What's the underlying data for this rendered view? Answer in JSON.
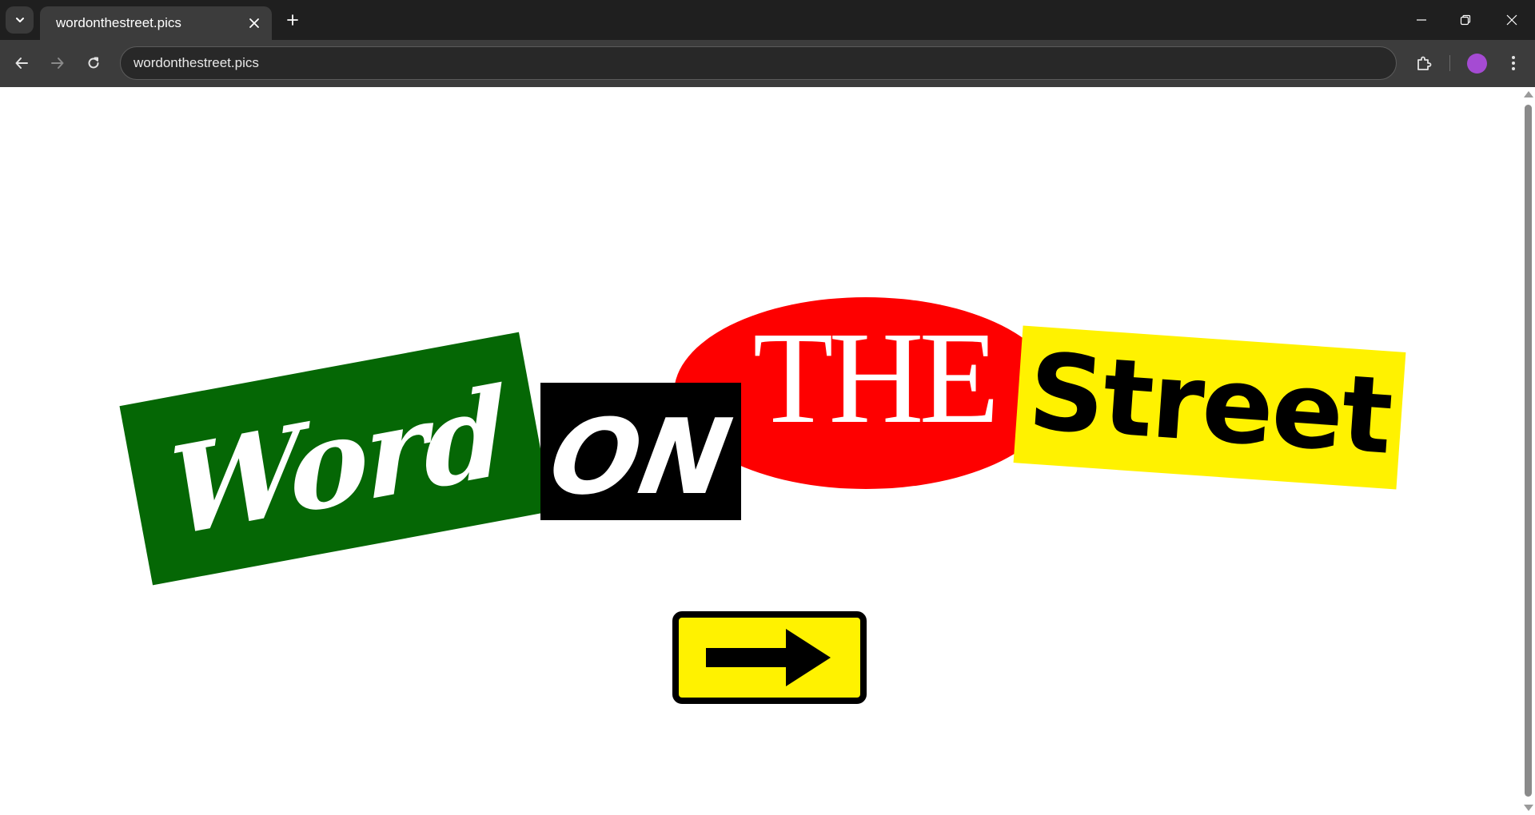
{
  "browser": {
    "tab": {
      "title": "wordonthestreet.pics",
      "close_icon": "close-icon"
    },
    "address_bar": {
      "url": "wordonthestreet.pics"
    },
    "profile_color": "#a54bd3",
    "icons": {
      "tab_search": "chevron-down-icon",
      "new_tab": "plus-icon",
      "minimize": "minimize-icon",
      "restore": "restore-icon",
      "close_window": "close-icon",
      "back": "back-arrow-icon",
      "forward": "forward-arrow-icon",
      "reload": "reload-icon",
      "extensions": "puzzle-piece-icon",
      "menu": "kebab-menu-icon"
    }
  },
  "page": {
    "logo": {
      "word": {
        "text": "Word",
        "background": "#056705",
        "color": "#ffffff"
      },
      "on": {
        "text": "ON",
        "background": "#000000",
        "color": "#ffffff"
      },
      "the": {
        "text": "THE",
        "background": "#fe0000",
        "color": "#ffffff"
      },
      "street": {
        "text": "Street",
        "background": "#fff200",
        "color": "#000000"
      }
    },
    "next_button": {
      "icon": "right-arrow-icon",
      "background": "#fff200",
      "border_color": "#000000"
    }
  }
}
